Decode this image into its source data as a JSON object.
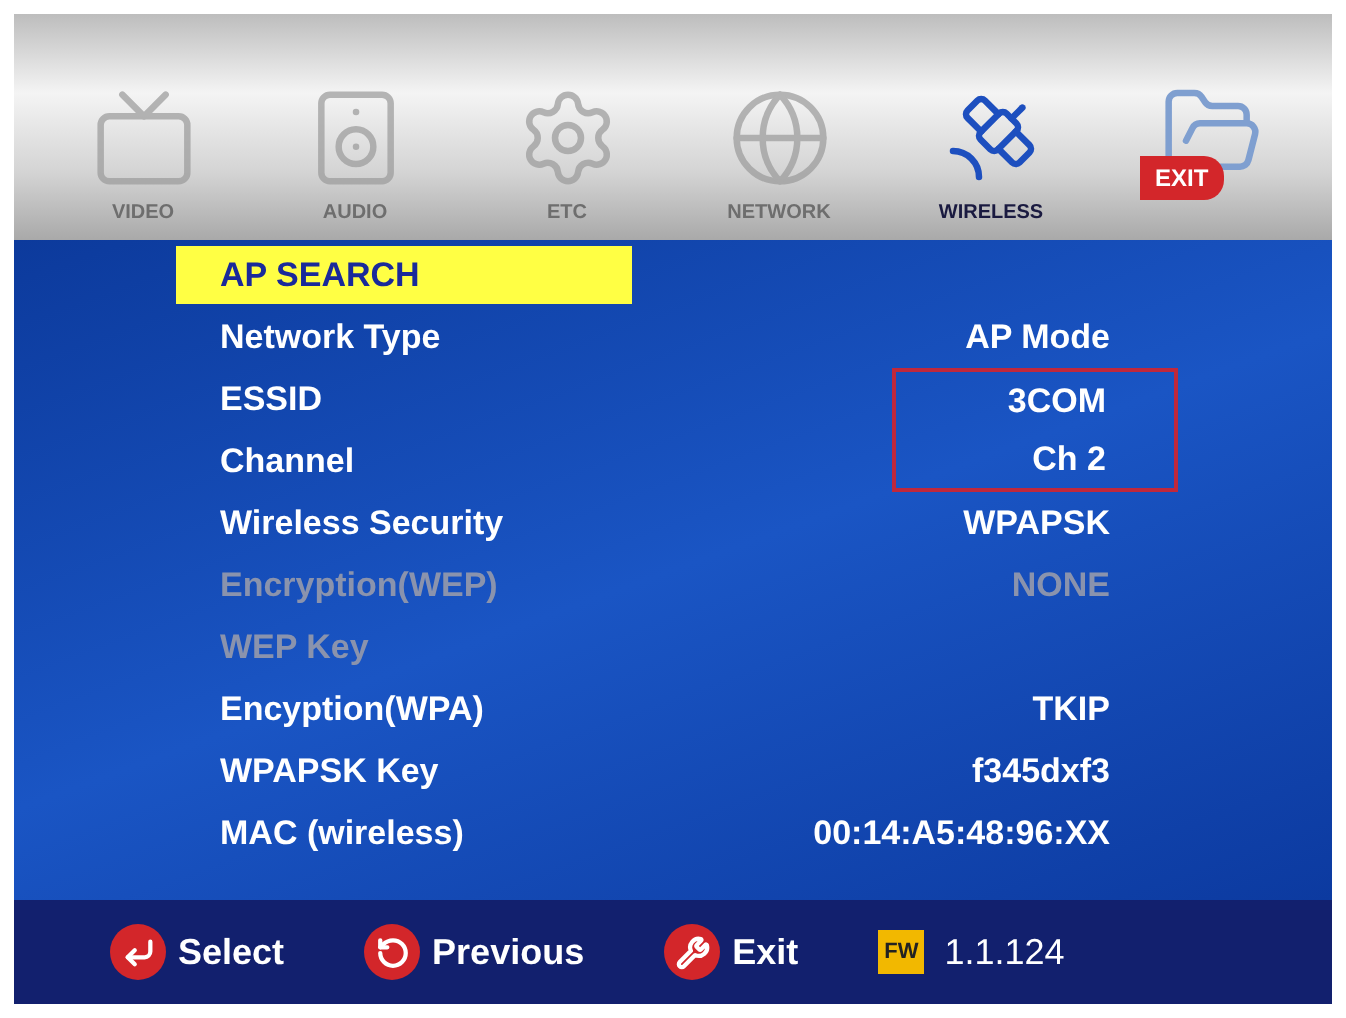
{
  "tabs": [
    {
      "label": "VIDEO",
      "selected": false
    },
    {
      "label": "AUDIO",
      "selected": false
    },
    {
      "label": "ETC",
      "selected": false
    },
    {
      "label": "NETWORK",
      "selected": false
    },
    {
      "label": "WIRELESS",
      "selected": true
    }
  ],
  "exit_button": {
    "label": "EXIT"
  },
  "settings": [
    {
      "label": "AP SEARCH",
      "selected": true,
      "disabled": false,
      "boxed": false
    },
    {
      "label": "Network Type",
      "value": "AP Mode",
      "selected": false,
      "disabled": false,
      "boxed": false
    },
    {
      "label": "ESSID",
      "value": "3COM",
      "selected": false,
      "disabled": false,
      "boxed": true
    },
    {
      "label": "Channel",
      "value": "Ch 2",
      "selected": false,
      "disabled": false,
      "boxed": true
    },
    {
      "label": "Wireless Security",
      "value": "WPAPSK",
      "selected": false,
      "disabled": false,
      "boxed": false
    },
    {
      "label": "Encryption(WEP)",
      "value": "NONE",
      "selected": false,
      "disabled": true,
      "boxed": false
    },
    {
      "label": "WEP Key",
      "selected": false,
      "disabled": true,
      "boxed": false
    },
    {
      "label": "Encyption(WPA)",
      "value": "TKIP",
      "selected": false,
      "disabled": false,
      "boxed": false
    },
    {
      "label": "WPAPSK Key",
      "value": "f345dxf3",
      "selected": false,
      "disabled": false,
      "boxed": false
    },
    {
      "label": "MAC (wireless)",
      "value": "00:14:A5:48:96:XX",
      "selected": false,
      "disabled": false,
      "boxed": false
    }
  ],
  "footer": {
    "hints": [
      {
        "label": "Select"
      },
      {
        "label": "Previous"
      },
      {
        "label": "Exit"
      }
    ],
    "fw_badge": "FW",
    "version": "1.1.124"
  }
}
